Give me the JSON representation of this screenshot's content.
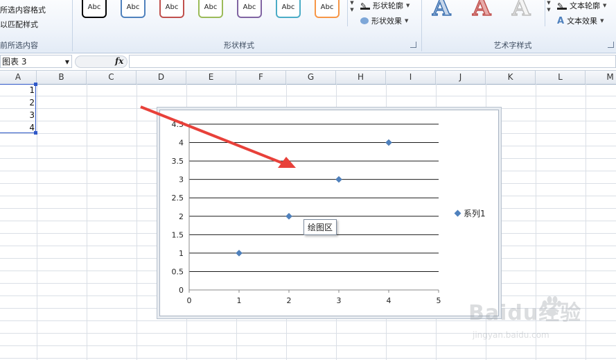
{
  "ribbon": {
    "left_items": [
      "所选内容格式",
      "以匹配样式",
      "前所选内容"
    ],
    "shape_styles_label": "形状样式",
    "wordart_styles_label": "艺术字样式",
    "swatches": [
      {
        "text": "Abc",
        "color": "#000000"
      },
      {
        "text": "Abc",
        "color": "#4f81bd"
      },
      {
        "text": "Abc",
        "color": "#c0504d"
      },
      {
        "text": "Abc",
        "color": "#9bbb59"
      },
      {
        "text": "Abc",
        "color": "#8064a2"
      },
      {
        "text": "Abc",
        "color": "#4bacc6"
      },
      {
        "text": "Abc",
        "color": "#f79646"
      }
    ],
    "shape_outline": "形状轮廓",
    "shape_effects": "形状效果",
    "text_outline": "文本轮廓",
    "text_effects": "文本效果",
    "wordart_letters": [
      "A",
      "A",
      "A"
    ]
  },
  "formula_bar": {
    "name_box": "图表 3",
    "fx": "fx",
    "formula": ""
  },
  "columns": [
    "A",
    "B",
    "C",
    "D",
    "E",
    "F",
    "G",
    "H",
    "I",
    "J",
    "K",
    "L",
    "M"
  ],
  "cells": {
    "A1": "1",
    "A2": "2",
    "A3": "3",
    "A4": "4"
  },
  "chart": {
    "tooltip": "绘图区",
    "legend": "系列1",
    "series_color": "#4f81bd",
    "annotation_arrow_color": "#e8413a"
  },
  "chart_data": {
    "type": "scatter",
    "x": [
      1,
      2,
      3,
      4
    ],
    "series": [
      {
        "name": "系列1",
        "values": [
          1,
          2,
          3,
          4
        ]
      }
    ],
    "xlim": [
      0,
      5
    ],
    "ylim": [
      0,
      4.5
    ],
    "x_ticks": [
      "0",
      "1",
      "2",
      "3",
      "4",
      "5"
    ],
    "y_ticks": [
      "0",
      "0.5",
      "1",
      "1.5",
      "2",
      "2.5",
      "3",
      "3.5",
      "4",
      "4.5"
    ],
    "grid": "horizontal",
    "legend": "right"
  },
  "watermark": {
    "text": "Baidu经验",
    "sub": "jingyan.baidu.com"
  }
}
